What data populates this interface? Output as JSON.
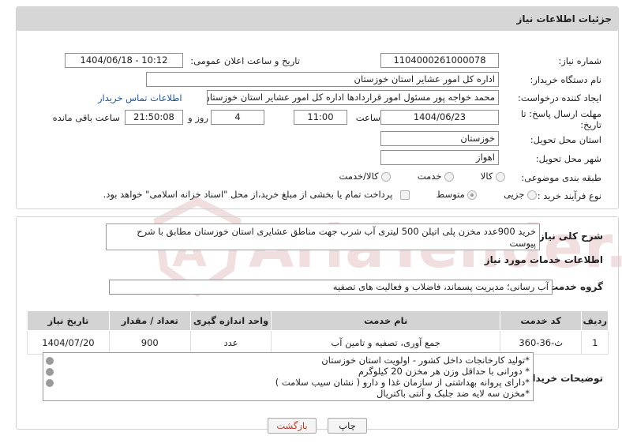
{
  "header": {
    "title": "جزئیات اطلاعات نیاز"
  },
  "form": {
    "need_number_label": "شماره نیاز:",
    "need_number": "1104000261000078",
    "announce_label": "تاریخ و ساعت اعلان عمومی:",
    "announce_value": "1404/06/18 - 10:12",
    "buyer_org_label": "نام دستگاه خریدار:",
    "buyer_org": "اداره کل امور عشایر استان خوزستان",
    "creator_label": "ایجاد کننده درخواست:",
    "creator": "محمد خواجه پور مسئول امور قراردادها اداره کل امور عشایر استان خوزستان",
    "contact_link": "اطلاعات تماس خریدار",
    "deadline_label_1": "مهلت ارسال پاسخ: تا",
    "deadline_label_2": "تاریخ:",
    "deadline_date": "1404/06/23",
    "time_label": "ساعت",
    "deadline_time": "11:00",
    "days_value": "4",
    "days_label": "روز و",
    "remaining_time": "21:50:08",
    "remaining_label": "ساعت باقی مانده",
    "province_label": "استان محل تحویل:",
    "province": "خوزستان",
    "city_label": "شهر محل تحویل:",
    "city": "اهواز",
    "category_label": "طبقه بندی موضوعی:",
    "category_options": [
      "کالا",
      "خدمت",
      "کالا/خدمت"
    ],
    "process_label": "نوع فرآیند خرید :",
    "process_options": [
      "جزیی",
      "متوسط"
    ],
    "payment_note": "پرداخت تمام یا بخشی از مبلغ خرید،از محل \"اسناد خزانه اسلامی\" خواهد بود."
  },
  "summary": {
    "label": "شرح کلی نیاز:",
    "text": "خرید 900عدد مخزن پلی اتیلن 500 لیتری آب شرب جهت مناطق  عشایری استان خوزستان مطابق با شرح پیوست"
  },
  "services": {
    "section_title": "اطلاعات خدمات مورد نیاز",
    "group_label": "گروه خدمت:",
    "group_value": "آب رسانی؛ مدیریت پسماند، فاضلاب و فعالیت های تصفیه",
    "table": {
      "headers": [
        "ردیف",
        "کد خدمت",
        "نام خدمت",
        "واحد اندازه گیری",
        "تعداد / مقدار",
        "تاریخ نیاز"
      ],
      "rows": [
        [
          "1",
          "ث-36-360",
          "جمع آوری، تصفیه و تامین آب",
          "عدد",
          "900",
          "1404/07/20"
        ]
      ]
    }
  },
  "buyer_notes": {
    "label": "توضیحات خریدار:",
    "lines": [
      "*تولید کارخانجات داخل کشور - اولویت استان خوزستان",
      "* دورانی با حداقل وزن هر مخزن 20 کیلوگرم",
      "*دارای پروانه بهداشتی از سازمان غذا و دارو ( نشان سیب سلامت )",
      "*مخزن سه لایه ضد جلبک و آنتی باکتریال"
    ]
  },
  "buttons": {
    "print": "چاپ",
    "back": "بازگشت"
  },
  "watermark": "AriaTender.neT",
  "colors": {
    "header_bg": "#d6d6d6",
    "link": "#1a56a8",
    "back_text": "#c0392b",
    "watermark": "#e3b0b0"
  }
}
